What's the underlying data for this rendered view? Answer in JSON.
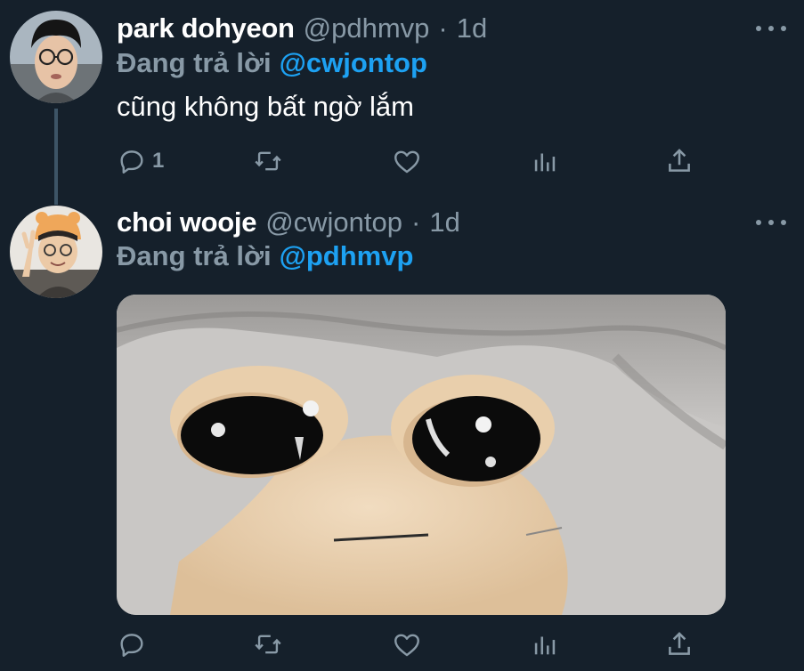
{
  "tweets": [
    {
      "author_name": "park dohyeon",
      "author_handle": "@pdhmvp",
      "separator": "·",
      "time": "1d",
      "reply_prefix": "Đang trả lời",
      "reply_to": "@cwjontop",
      "text": "cũng không bất ngờ lắm",
      "actions": {
        "reply_count": "1",
        "retweet_count": "",
        "like_count": ""
      }
    },
    {
      "author_name": "choi wooje",
      "author_handle": "@cwjontop",
      "separator": "·",
      "time": "1d",
      "reply_prefix": "Đang trả lời",
      "reply_to": "@pdhmvp",
      "text": "",
      "actions": {
        "reply_count": "",
        "retweet_count": "",
        "like_count": ""
      }
    }
  ],
  "icons": {
    "reply": "speech-bubble-icon",
    "retweet": "retweet-arrows-icon",
    "like": "heart-icon",
    "analytics": "bar-chart-icon",
    "share": "share-upload-icon",
    "more": "ellipsis-icon"
  },
  "colors": {
    "background": "#15202b",
    "text_primary": "#ffffff",
    "text_secondary": "#8899a6",
    "accent_link": "#1da1f2",
    "thread_line": "#3d5466"
  }
}
